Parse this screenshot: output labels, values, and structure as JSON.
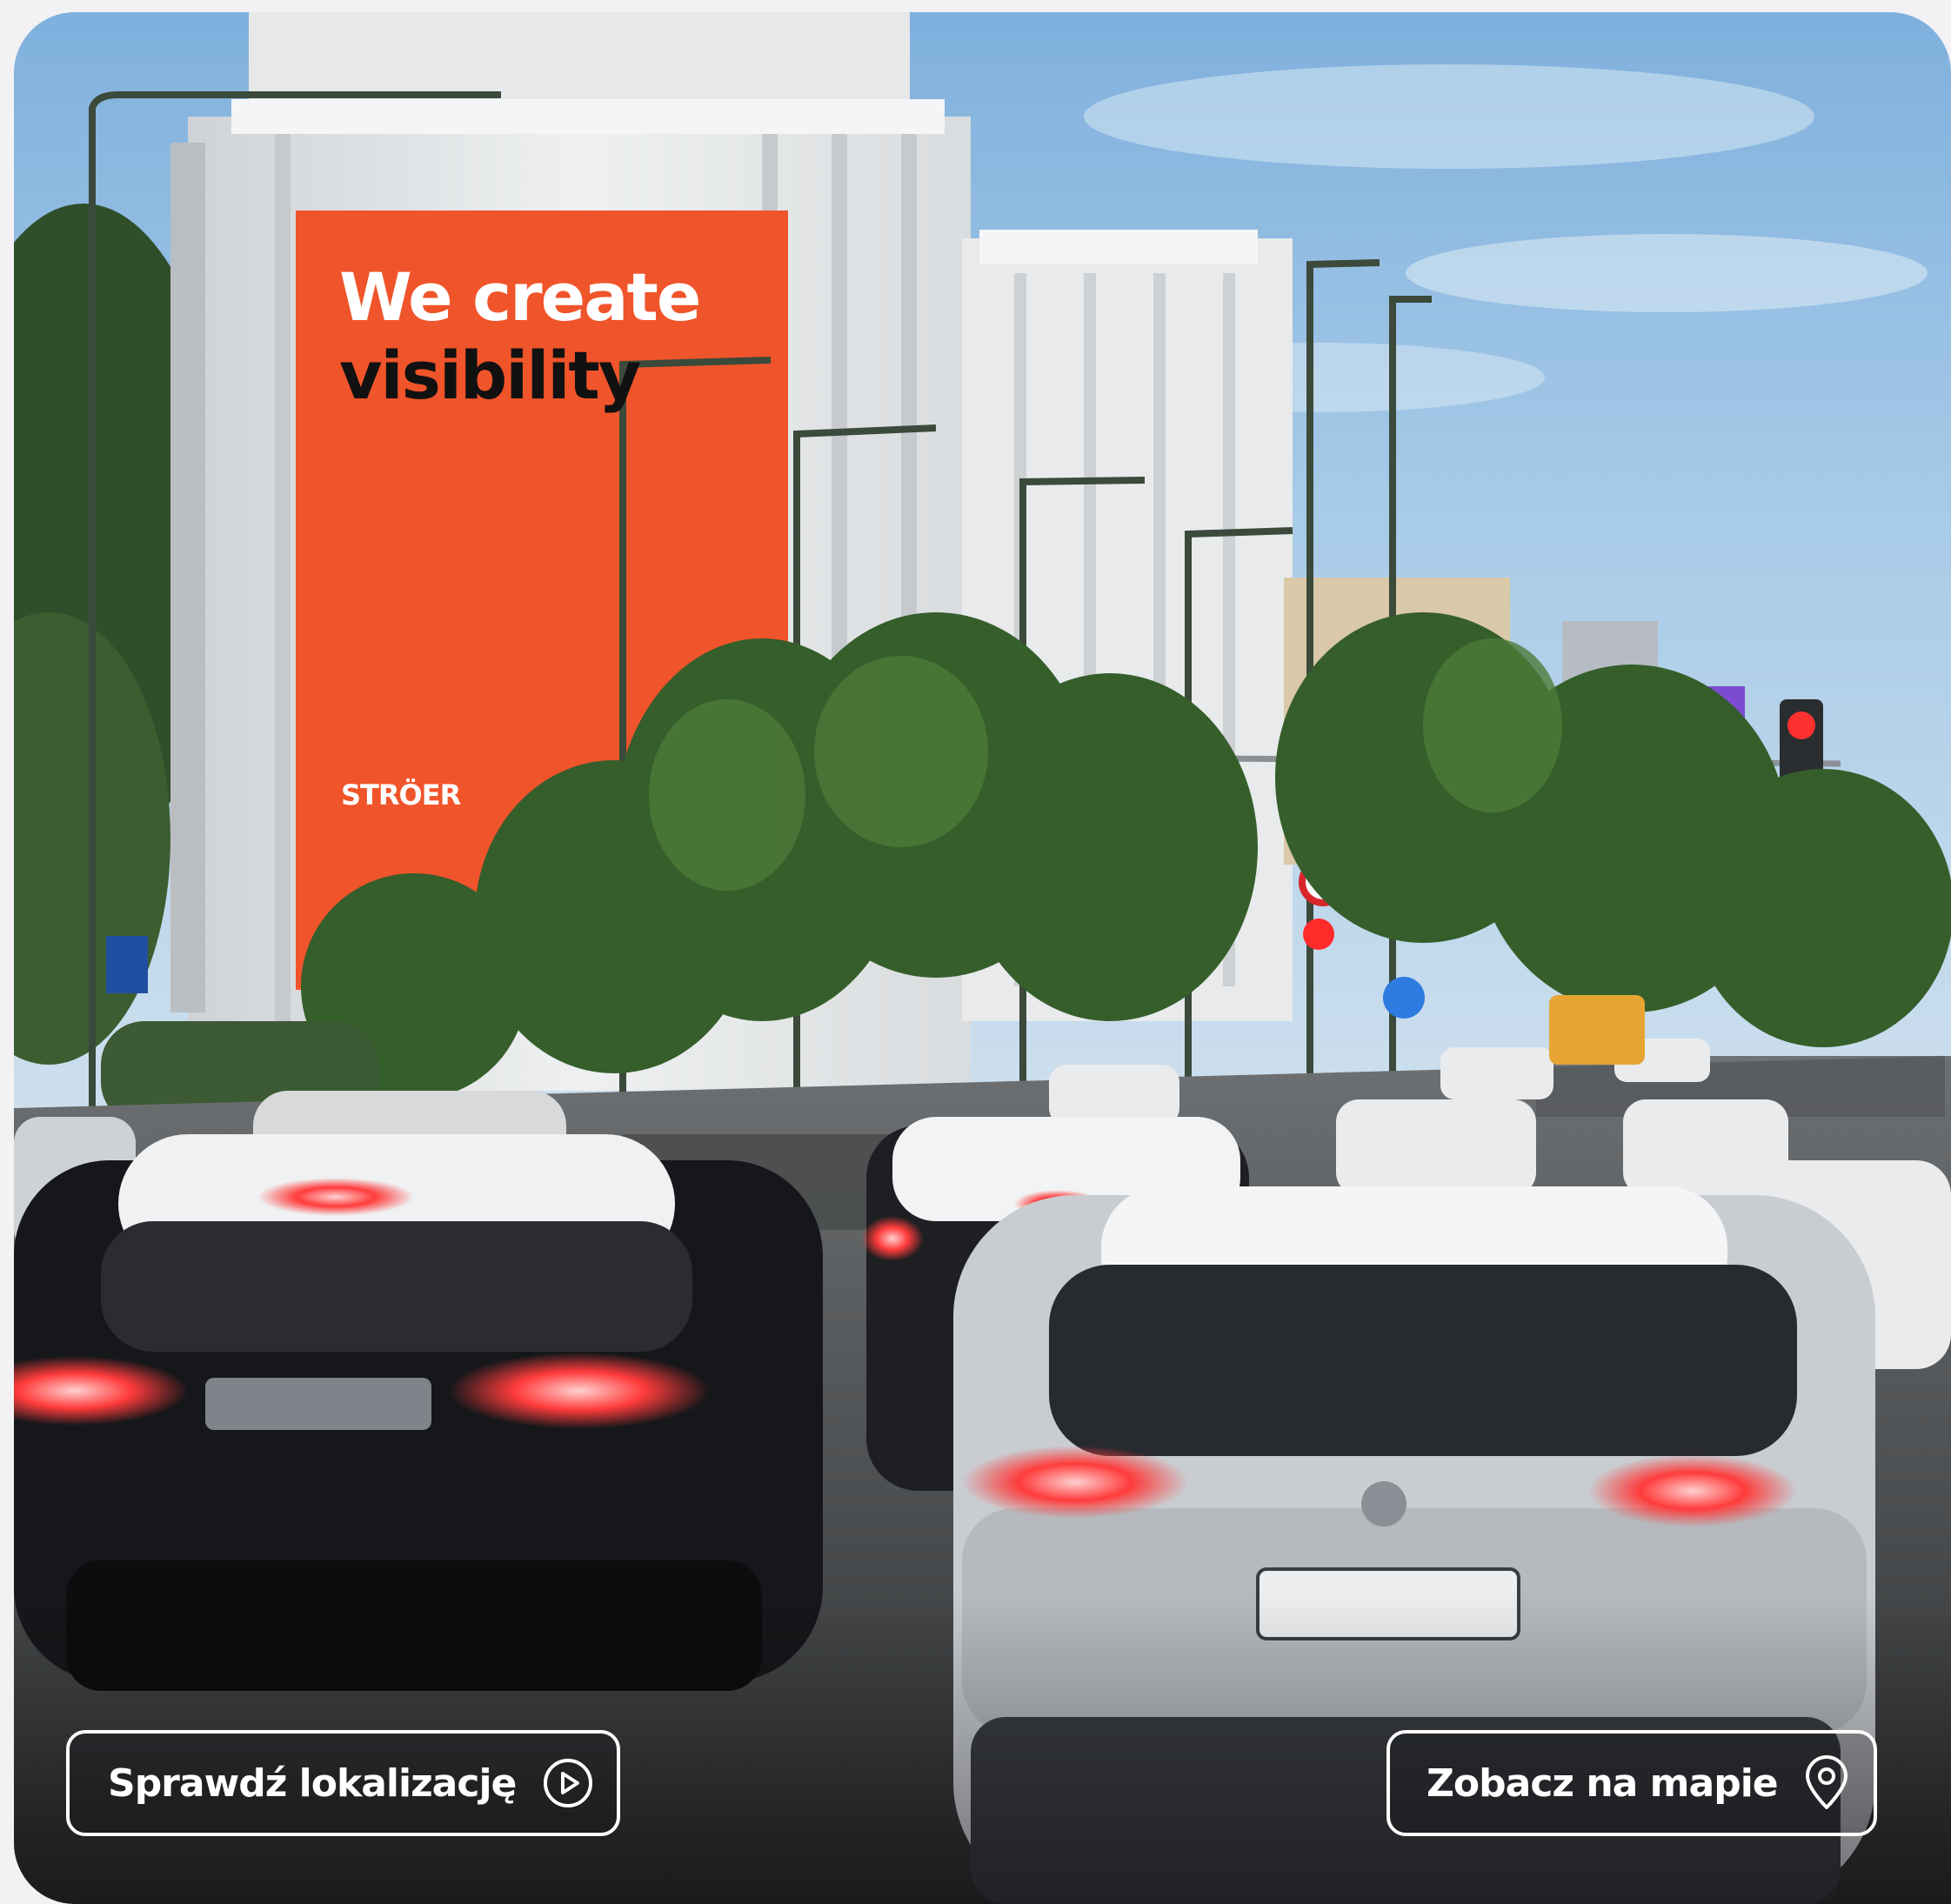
{
  "billboard": {
    "headline_line1": "We create",
    "headline_line2": "visibility",
    "brand": "STRÖER",
    "color": "#f0542a"
  },
  "actions": {
    "check_location": {
      "label": "Sprawdź lokalizację",
      "icon": "play-circle-icon"
    },
    "view_map": {
      "label": "Zobacz na mapie",
      "icon": "map-pin-icon"
    }
  }
}
